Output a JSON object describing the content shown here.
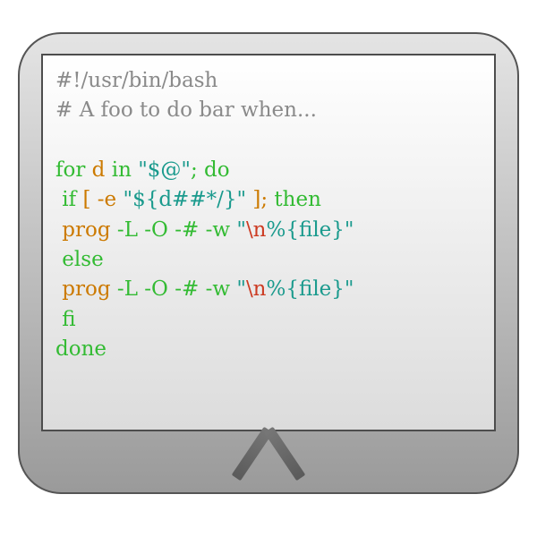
{
  "code": {
    "line1_shebang": "#!/usr/bin/bash",
    "line2_comment": "# A foo to do bar when...",
    "line3_for": "for",
    "line3_var": " d ",
    "line3_in": "in ",
    "line3_str": "\"$@\"",
    "line3_dodo": "; do",
    "line4_if": " if",
    "line4_cond_open": " [ -e ",
    "line4_str": "\"${d##*/}\"",
    "line4_cond_close": " ]; ",
    "line4_then": "then",
    "line5_prog": " prog",
    "line5_flags": " -L -O -# -w ",
    "line5_q1": "\"",
    "line5_esc": "\\n",
    "line5_rest": "%{file}\"",
    "line6_else": " else",
    "line7_prog": " prog",
    "line7_flags": " -L -O -# -w ",
    "line7_q1": "\"",
    "line7_esc": "\\n",
    "line7_rest": "%{file}\"",
    "line8_fi": " fi",
    "line9_done": "done"
  }
}
